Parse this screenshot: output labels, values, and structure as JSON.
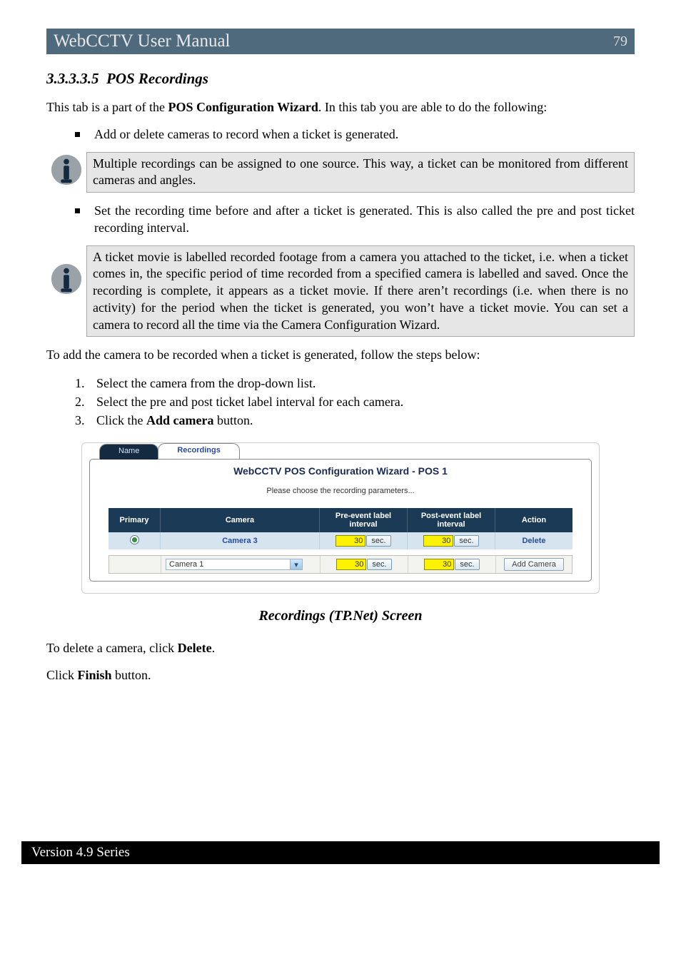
{
  "header": {
    "title": "WebCCTV User Manual",
    "page_number": "79"
  },
  "section": {
    "number": "3.3.3.3.5",
    "title": "POS Recordings",
    "intro_before": "This tab is a part of the ",
    "intro_bold": "POS Configuration Wizard",
    "intro_after": ". In this tab you are able to do the following:",
    "bullet1": "Add or delete cameras to record when a ticket is generated.",
    "note1": "Multiple recordings can be assigned to one source. This way, a ticket can be monitored from different cameras and angles.",
    "bullet2": "Set the recording time before and after a ticket is generated. This is also called the pre and post ticket recording interval.",
    "note2": "A ticket movie is labelled recorded footage from a camera you attached to the ticket, i.e. when a ticket comes in, the specific period of time recorded from a specified camera is labelled and saved. Once the recording is complete, it appears as a ticket movie. If there aren’t recordings (i.e. when there is no activity) for the period when the ticket is generated, you won’t have a ticket movie. You can set a camera to record all the time via the Camera Configuration Wizard.",
    "to_add": "To add the camera to be recorded when a ticket is generated, follow the steps below:",
    "steps": [
      "Select the camera from the drop-down list.",
      "Select the pre and post ticket label interval for each camera.",
      {
        "pre": "Click the ",
        "bold": "Add camera",
        "post": " button."
      }
    ],
    "caption": "Recordings (TP.Net) Screen",
    "delete_line_pre": "To delete a camera, click ",
    "delete_line_bold": "Delete",
    "delete_line_post": ".",
    "finish_pre": "Click ",
    "finish_bold": "Finish",
    "finish_post": " button."
  },
  "wizard": {
    "tab_name": "Name",
    "tab_recordings": "Recordings",
    "title": "WebCCTV POS Configuration Wizard - POS 1",
    "subtitle": "Please choose the recording parameters...",
    "headers": {
      "primary": "Primary",
      "camera": "Camera",
      "pre": "Pre-event label interval",
      "post": "Post-event label interval",
      "action": "Action"
    },
    "row": {
      "camera": "Camera 3",
      "pre_val": "30",
      "post_val": "30",
      "sec": "sec.",
      "delete": "Delete"
    },
    "add": {
      "dropdown": "Camera 1",
      "pre_val": "30",
      "post_val": "30",
      "sec": "sec.",
      "button": "Add Camera"
    }
  },
  "footer": {
    "version": "Version 4.9 Series"
  }
}
